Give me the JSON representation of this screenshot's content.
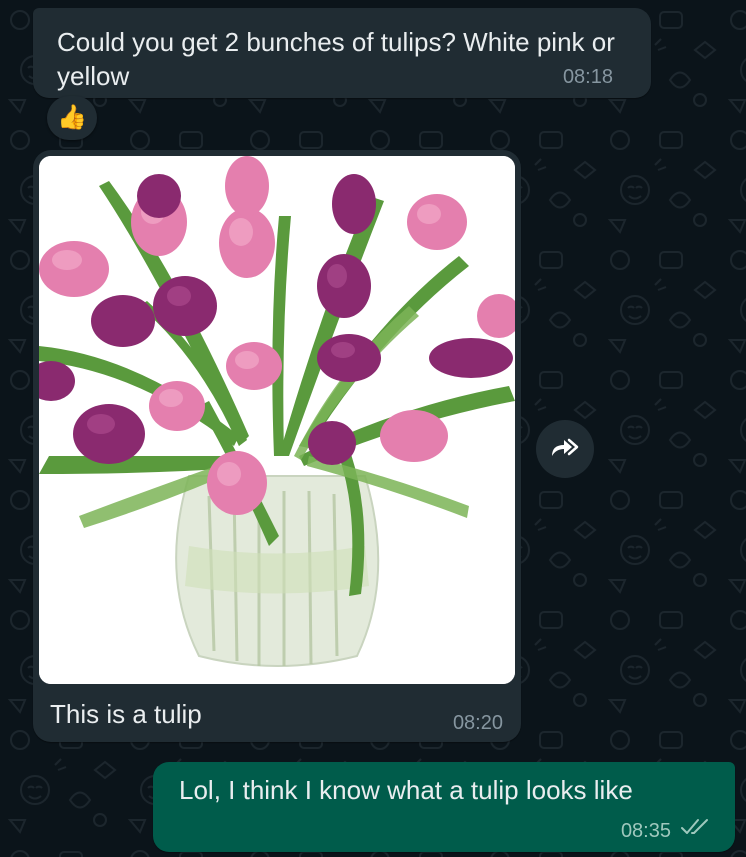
{
  "messages": [
    {
      "direction": "incoming",
      "text": "Could you get 2 bunches of tulips? White pink or yellow",
      "time": "08:18",
      "reaction": "👍"
    },
    {
      "direction": "incoming",
      "type": "image",
      "image_subject": "bouquet of pink and purple tulips in a glass vase",
      "caption": "This is a tulip",
      "time": "08:20"
    },
    {
      "direction": "outgoing",
      "text": "Lol, I think I know what a tulip looks like",
      "time": "08:35",
      "status": "read-ticks"
    }
  ],
  "icons": {
    "forward": "forward-icon",
    "thumbs_up": "thumbs-up-icon",
    "read": "double-check-icon"
  },
  "colors": {
    "background": "#0b141a",
    "incoming_bubble": "#202c33",
    "outgoing_bubble": "#005c4b",
    "timestamp": "#8696a0"
  }
}
